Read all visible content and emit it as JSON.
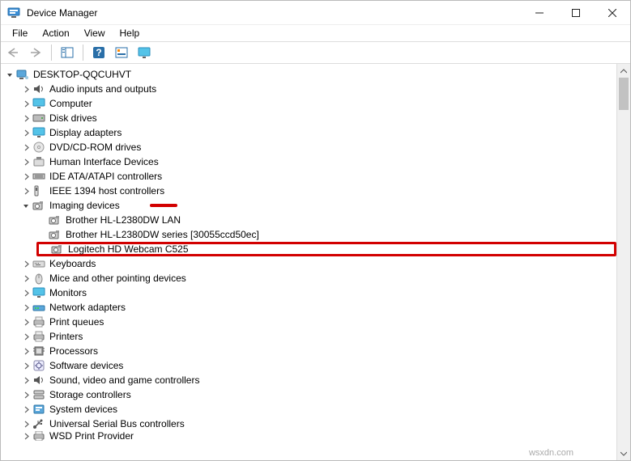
{
  "window": {
    "title": "Device Manager"
  },
  "menubar": [
    "File",
    "Action",
    "View",
    "Help"
  ],
  "root": {
    "label": "DESKTOP-QQCUHVT",
    "expanded": true
  },
  "categories": [
    {
      "label": "Audio inputs and outputs",
      "icon": "speaker",
      "expanded": false
    },
    {
      "label": "Computer",
      "icon": "monitor",
      "expanded": false
    },
    {
      "label": "Disk drives",
      "icon": "drive",
      "expanded": false
    },
    {
      "label": "Display adapters",
      "icon": "monitor",
      "expanded": false
    },
    {
      "label": "DVD/CD-ROM drives",
      "icon": "disc",
      "expanded": false
    },
    {
      "label": "Human Interface Devices",
      "icon": "hid",
      "expanded": false
    },
    {
      "label": "IDE ATA/ATAPI controllers",
      "icon": "ide",
      "expanded": false
    },
    {
      "label": "IEEE 1394 host controllers",
      "icon": "firewire",
      "expanded": false
    },
    {
      "label": "Imaging devices",
      "icon": "camera",
      "expanded": true,
      "strike": true,
      "children": [
        {
          "label": "Brother HL-L2380DW LAN",
          "icon": "camera"
        },
        {
          "label": "Brother HL-L2380DW series [30055ccd50ec]",
          "icon": "camera"
        },
        {
          "label": "Logitech HD Webcam C525",
          "icon": "camera",
          "highlight": true
        }
      ]
    },
    {
      "label": "Keyboards",
      "icon": "keyboard",
      "expanded": false
    },
    {
      "label": "Mice and other pointing devices",
      "icon": "mouse",
      "expanded": false
    },
    {
      "label": "Monitors",
      "icon": "monitor",
      "expanded": false
    },
    {
      "label": "Network adapters",
      "icon": "network",
      "expanded": false
    },
    {
      "label": "Print queues",
      "icon": "printer",
      "expanded": false
    },
    {
      "label": "Printers",
      "icon": "printer",
      "expanded": false
    },
    {
      "label": "Processors",
      "icon": "cpu",
      "expanded": false
    },
    {
      "label": "Software devices",
      "icon": "software",
      "expanded": false
    },
    {
      "label": "Sound, video and game controllers",
      "icon": "speaker",
      "expanded": false
    },
    {
      "label": "Storage controllers",
      "icon": "storage",
      "expanded": false
    },
    {
      "label": "System devices",
      "icon": "system",
      "expanded": false
    },
    {
      "label": "Universal Serial Bus controllers",
      "icon": "usb",
      "expanded": false
    },
    {
      "label": "WSD Print Provider",
      "icon": "printer",
      "expanded": false,
      "partial": true
    }
  ],
  "watermark": "wsxdn.com"
}
